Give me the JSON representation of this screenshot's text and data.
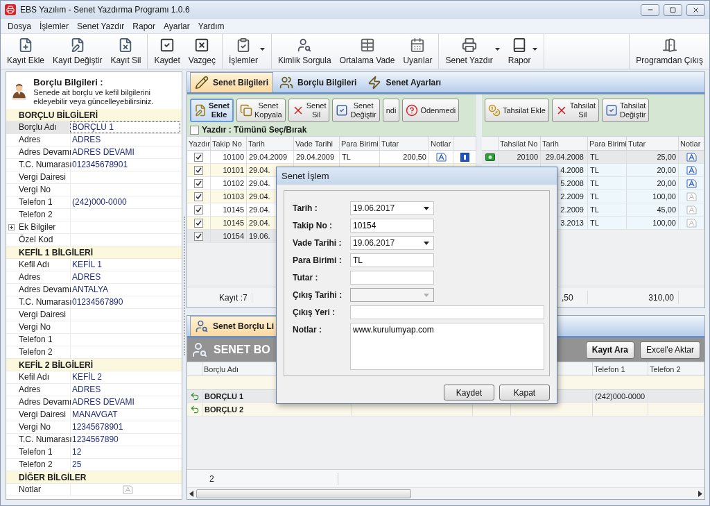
{
  "window": {
    "title": "EBS Yazılım - Senet Yazdırma Programı 1.0.6"
  },
  "menu": [
    "Dosya",
    "İşlemler",
    "Senet Yazdır",
    "Rapor",
    "Ayarlar",
    "Yardım"
  ],
  "toolbar": [
    [
      {
        "label": "Kayıt Ekle",
        "dropdown": false
      },
      {
        "label": "Kayıt Değiştir",
        "dropdown": false
      },
      {
        "label": "Kayıt Sil",
        "dropdown": false
      }
    ],
    [
      {
        "label": "Kaydet",
        "dropdown": false
      },
      {
        "label": "Vazgeç",
        "dropdown": false
      }
    ],
    [
      {
        "label": "İşlemler",
        "dropdown": true
      }
    ],
    [
      {
        "label": "Kimlik Sorgula",
        "dropdown": false
      },
      {
        "label": "Ortalama Vade",
        "dropdown": false
      },
      {
        "label": "Uyarılar",
        "dropdown": false
      }
    ],
    [
      {
        "label": "Senet Yazdır",
        "dropdown": true
      },
      {
        "label": "Rapor",
        "dropdown": true
      }
    ],
    [
      {
        "label": "Programdan Çıkış",
        "dropdown": false
      }
    ]
  ],
  "borclu_panel": {
    "title": "Borçlu Bilgileri :",
    "description": "Senede ait borçlu ve kefil bilgilerini ekleyebilir veya güncelleyebilirsiniz.",
    "sections": [
      {
        "title": "BORÇLU BİLGİLERİ",
        "rows": [
          {
            "label": "Borçlu Adı",
            "value": "BORÇLU 1",
            "selected": true
          },
          {
            "label": "Adres",
            "value": "ADRES",
            "selected": false
          },
          {
            "label": "Adres Devamı",
            "value": "ADRES DEVAMI",
            "selected": false
          },
          {
            "label": "T.C. Numarası",
            "value": "012345678901",
            "selected": false
          },
          {
            "label": "Vergi Dairesi",
            "selected": false
          },
          {
            "label": "Vergi No",
            "selected": false
          },
          {
            "label": "Telefon 1",
            "value": "(242)000-0000",
            "selected": false
          },
          {
            "label": "Telefon 2",
            "selected": false
          },
          {
            "label": "Ek Bilgiler",
            "selected": false,
            "expanded": false
          },
          {
            "label": "Özel Kod",
            "selected": false
          }
        ]
      },
      {
        "title": "KEFİL 1 BİLGİLERİ",
        "rows": [
          {
            "label": "Kefil Adı",
            "value": "KEFİL 1",
            "selected": false
          },
          {
            "label": "Adres",
            "value": "ADRES",
            "selected": false
          },
          {
            "label": "Adres Devamı",
            "value": "ANTALYA",
            "selected": false
          },
          {
            "label": "T.C. Numarası",
            "value": "01234567890",
            "selected": false
          },
          {
            "label": "Vergi Dairesi",
            "selected": false
          },
          {
            "label": "Vergi No",
            "selected": false
          },
          {
            "label": "Telefon 1",
            "selected": false
          },
          {
            "label": "Telefon 2",
            "selected": false
          }
        ]
      },
      {
        "title": "KEFİL 2 BİLGİLERİ",
        "rows": [
          {
            "label": "Kefil Adı",
            "value": "KEFİL 2",
            "selected": false
          },
          {
            "label": "Adres",
            "value": "ADRES",
            "selected": false
          },
          {
            "label": "Adres Devamı",
            "value": "ADRES DEVAMI",
            "selected": false
          },
          {
            "label": "Vergi Dairesi",
            "value": "MANAVGAT",
            "selected": false
          },
          {
            "label": "Vergi No",
            "value": "12345678901",
            "selected": false
          },
          {
            "label": "T.C. Numarası",
            "value": "1234567890",
            "selected": false
          },
          {
            "label": "Telefon 1",
            "value": "12",
            "selected": false
          },
          {
            "label": "Telefon 2",
            "value": "25",
            "selected": false
          }
        ]
      },
      {
        "title": "DİĞER BİLGİLER",
        "rows": [
          {
            "label": "Notlar",
            "selected": false,
            "has_note": false
          }
        ]
      }
    ]
  },
  "senet_tabs": [
    {
      "label": "Senet Bilgileri",
      "selected": true
    },
    {
      "label": "Borçlu Bilgileri",
      "selected": false
    },
    {
      "label": "Senet Ayarları",
      "selected": false
    }
  ],
  "senet_buttons": [
    {
      "label": "Senet Ekle",
      "selected": true
    },
    {
      "label": "Senet Kopyala",
      "selected": false
    },
    {
      "label": "Senet Sil",
      "selected": false
    },
    {
      "label": "Senet Değiştir",
      "selected": false
    },
    {
      "label": "ndi",
      "selected": false
    },
    {
      "label": "Ödenmedi",
      "selected": false
    }
  ],
  "select_all": {
    "label": "Yazdır : Tümünü Seç/Bırak",
    "checked": false
  },
  "senet_table": {
    "columns": [
      "Yazdır",
      "Takip No",
      "Tarih",
      "Vade Tarihi",
      "Para Birimi",
      "Tutar",
      "Notlar"
    ],
    "rows": [
      {
        "checked": true,
        "takip_no": "10100",
        "tarih": "29.04.2009",
        "vade_tarihi": "29.04.2009",
        "para_birimi": "TL",
        "tutar": "200,50",
        "has_note": true,
        "marked": true,
        "selected": false
      },
      {
        "checked": true,
        "takip_no": "10101",
        "tarih": "29.04.",
        "selected": false
      },
      {
        "checked": true,
        "takip_no": "10102",
        "tarih": "29.04.",
        "selected": false
      },
      {
        "checked": true,
        "takip_no": "10103",
        "tarih": "29.04.",
        "selected": false
      },
      {
        "checked": true,
        "takip_no": "10145",
        "tarih": "29.04.",
        "selected": false
      },
      {
        "checked": true,
        "takip_no": "10145",
        "tarih": "29.04.",
        "selected": false
      },
      {
        "checked": true,
        "takip_no": "10154",
        "tarih": "19.06.",
        "selected": true
      }
    ],
    "footer": "Kayıt :7"
  },
  "tahsilat_buttons": [
    "Tahsilat Ekle",
    "Tahsilat Sil",
    "Tahsilat Değiştir"
  ],
  "tahsilat_table": {
    "columns": [
      "Tahsilat No",
      "Tarih",
      "Para Birimi",
      "Tutar",
      "Notlar"
    ],
    "rows": [
      {
        "tahsilat_no": "20100",
        "tarih": "29.04.2008",
        "para_birimi": "TL",
        "tutar": "25,00",
        "has_note": true,
        "selected": true
      },
      {
        "tarih": "4.2008",
        "para_birimi": "TL",
        "tutar": "20,00",
        "has_note": true,
        "selected": false
      },
      {
        "tarih": "5.2008",
        "para_birimi": "TL",
        "tutar": "20,00",
        "has_note": true,
        "selected": false
      },
      {
        "tarih": "2.2009",
        "para_birimi": "TL",
        "tutar": "100,00",
        "has_note": false,
        "selected": false
      },
      {
        "tarih": "2.2009",
        "para_birimi": "TL",
        "tutar": "45,00",
        "has_note": false,
        "selected": false
      },
      {
        "tarih": "3.2013",
        "para_birimi": "TL",
        "tutar": "100,00",
        "has_note": false,
        "selected": false
      }
    ],
    "footer": {
      "tarih": ",50",
      "tutar": "310,00"
    }
  },
  "liste_tab": {
    "label": "Senet Borçlu Li",
    "selected": true
  },
  "liste_header": {
    "title": "SENET BO",
    "buttons": [
      "Kayıt Ara",
      "Excel'e Aktar"
    ]
  },
  "borclu_list": {
    "columns": [
      "Borçlu Adı",
      "Telefon 1",
      "Telefon 2"
    ],
    "rows": [
      {
        "name": "BORÇLU 1",
        "telefon_1": "(242)000-0000",
        "selected": true
      },
      {
        "name": "BORÇLU 2",
        "selected": false
      }
    ],
    "footer": "2"
  },
  "dialog": {
    "title": "Senet İşlem",
    "fields": [
      {
        "label": "Tarih :",
        "value": "19.06.2017",
        "kind": "combo",
        "disabled": false
      },
      {
        "label": "Takip No :",
        "value": "10154",
        "kind": "text"
      },
      {
        "label": "Vade Tarihi :",
        "value": "19.06.2017",
        "kind": "combo",
        "disabled": false
      },
      {
        "label": "Para Birimi :",
        "value": "TL",
        "kind": "text"
      },
      {
        "label": "Tutar :",
        "kind": "text"
      },
      {
        "label": "Çıkış Tarihi :",
        "kind": "combo",
        "disabled": true
      },
      {
        "label": "Çıkış Yeri :",
        "kind": "wide"
      },
      {
        "label": "Notlar :",
        "value": "www.kurulumyap.com",
        "kind": "memo"
      }
    ],
    "buttons": [
      "Kaydet",
      "Kapat"
    ]
  }
}
